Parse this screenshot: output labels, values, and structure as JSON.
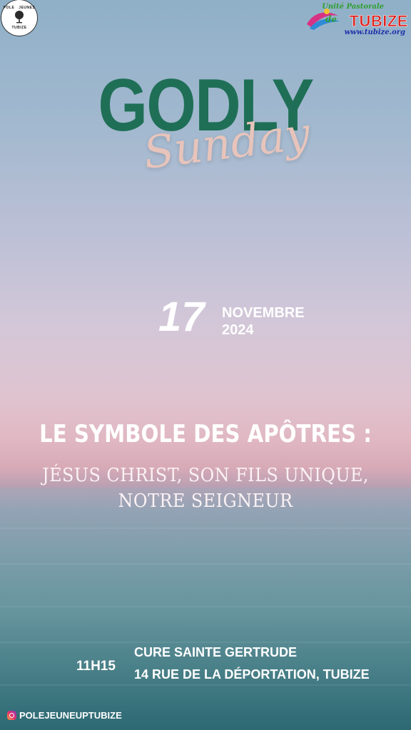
{
  "logos": {
    "pole_jeunes": {
      "top_left": "POLE",
      "top_right": "JEUNES",
      "bottom": "TUBIZE",
      "icon": "tree-cross-icon"
    },
    "unite_pastorale": {
      "line1": "Unité Pastorale",
      "line2": "TUBIZE",
      "line3": "www.tubize.org",
      "prefix": "de"
    }
  },
  "headline": {
    "title": "GODLY",
    "subtitle": "Sunday"
  },
  "date": {
    "day": "17",
    "month": "NOVEMBRE",
    "year": "2024"
  },
  "theme": {
    "line1": "LE SYMBOLE DES APÔTRES :",
    "line2": "JÉSUS CHRIST, SON FILS UNIQUE,",
    "line3": "NOTRE SEIGNEUR"
  },
  "event": {
    "time": "11H15",
    "place": "CURE SAINTE GERTRUDE",
    "address": "14 RUE DE LA DÉPORTATION, TUBIZE"
  },
  "social": {
    "icon": "instagram-icon",
    "handle": "POLEJEUNEUPTUBIZE"
  },
  "colors": {
    "title_green": "#1f6f57",
    "sunday_pink": "#e7c4bb",
    "text_white": "#ffffff"
  }
}
